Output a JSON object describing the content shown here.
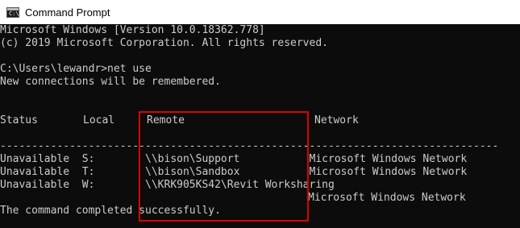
{
  "window": {
    "title": "Command Prompt",
    "icon": "command-prompt-icon",
    "icon_glyph": "C:\\"
  },
  "console": {
    "lines": [
      "Microsoft Windows [Version 10.0.18362.778]",
      "(c) 2019 Microsoft Corporation. All rights reserved.",
      "C:\\Users\\lewandr>net use",
      "New connections will be remembered.",
      "Status",
      "Local",
      "Remote",
      "Network",
      "-------------------------------------------------------------------------------",
      "Unavailable  S:        \\\\bison\\Support           Microsoft Windows Network",
      "Unavailable  T:        \\\\bison\\Sandbox           Microsoft Windows Network",
      "Unavailable  W:        \\\\KRK905KS42\\Revit Worksharing",
      "Microsoft Windows Network",
      "The command completed successfully."
    ]
  },
  "colors": {
    "background": "#0c0c0c",
    "text": "#cccccc",
    "highlight": "#e00000"
  }
}
